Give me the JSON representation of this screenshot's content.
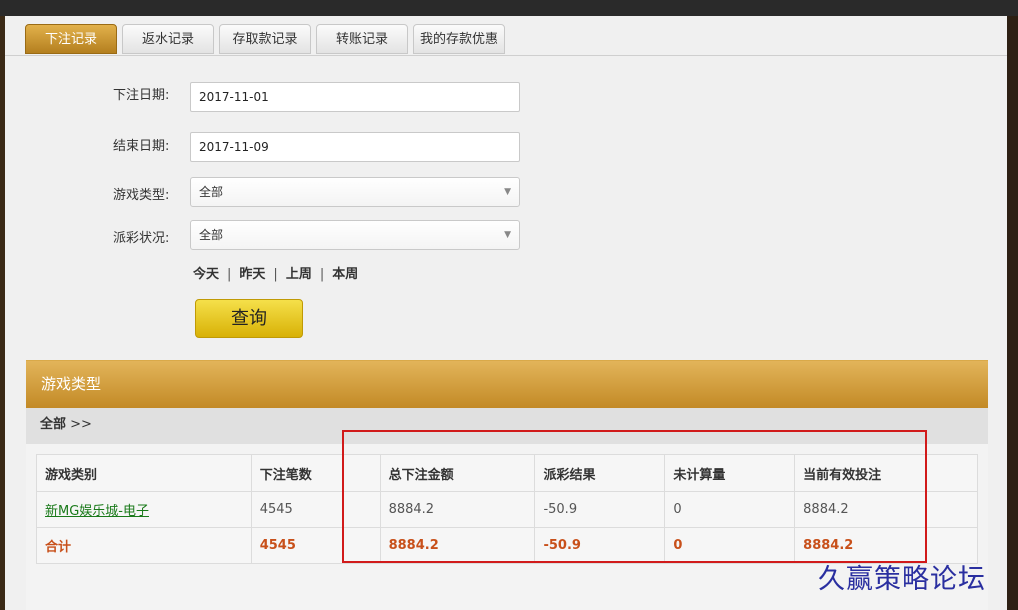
{
  "tabs": [
    {
      "label": "下注记录",
      "active": true
    },
    {
      "label": "返水记录",
      "active": false
    },
    {
      "label": "存取款记录",
      "active": false
    },
    {
      "label": "转账记录",
      "active": false
    },
    {
      "label": "我的存款优惠",
      "active": false
    }
  ],
  "form": {
    "start_label": "下注日期:",
    "start_value": "2017-11-01",
    "end_label": "结束日期:",
    "end_value": "2017-11-09",
    "game_type_label": "游戏类型:",
    "game_type_value": "全部",
    "payout_label": "派彩状况:",
    "payout_value": "全部",
    "quick_ranges": [
      "今天",
      "昨天",
      "上周",
      "本周"
    ],
    "query_label": "查询"
  },
  "result": {
    "header": "游戏类型",
    "crumb_main": "全部",
    "crumb_arrow": ">>",
    "columns": [
      "游戏类别",
      "下注笔数",
      "总下注金额",
      "派彩结果",
      "未计算量",
      "当前有效投注"
    ],
    "rows": [
      {
        "game": "新MG娱乐城-电子",
        "count": "4545",
        "total": "8884.2",
        "payout": "-50.9",
        "pending": "0",
        "valid": "8884.2"
      }
    ],
    "total": {
      "label": "合计",
      "count": "4545",
      "total": "8884.2",
      "payout": "-50.9",
      "pending": "0",
      "valid": "8884.2"
    }
  },
  "watermark": "久赢策略论坛",
  "colors": {
    "accent": "#c38a26",
    "highlight_box": "#d11a1a",
    "total_text": "#c8501a",
    "link": "#1a7a1a"
  }
}
